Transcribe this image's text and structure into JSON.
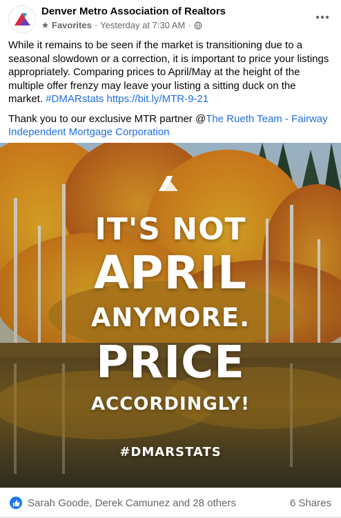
{
  "post": {
    "page_name": "Denver Metro Association of Realtors",
    "audience_label": "Favorites",
    "time_label": "Yesterday at 7:30 AM",
    "separator": "·",
    "text_p1_main": "While it remains to be seen if the market is transitioning due to a seasonal slowdown or a correction, it is important to price your listings appropriately. Comparing prices to April/May at the height of the multiple offer frenzy may leave your listing a sitting duck on the market. ",
    "hashtag": "#DMARstats",
    "short_link": "https://bit.ly/MTR-9-21",
    "text_p2_main": "Thank you to our exclusive MTR partner @",
    "partner_link": "The Rueth Team - Fairway Independent Mortgage Corporation"
  },
  "image": {
    "line1": "IT'S NOT",
    "line2": "APRIL",
    "line3": "ANYMORE.",
    "line4": "PRICE",
    "line5": "ACCORDINGLY!",
    "hashtag": "#DMARSTATS"
  },
  "footer": {
    "reactors": "Sarah Goode, Derek Camunez and 28 others",
    "shares": "6 Shares"
  },
  "colors": {
    "link": "#216fdb",
    "meta": "#65676b",
    "like_blue": "#1877f2",
    "brand_red": "#e0263f",
    "brand_purple": "#6a3fb2",
    "brand_blue": "#2b9be0"
  },
  "icons": {
    "avatar": "dmar-logo-icon",
    "audience": "star-icon",
    "privacy": "globe-icon",
    "more": "more-dots-icon",
    "like": "thumbs-up-icon",
    "image_logo": "dmar-logo-icon"
  }
}
